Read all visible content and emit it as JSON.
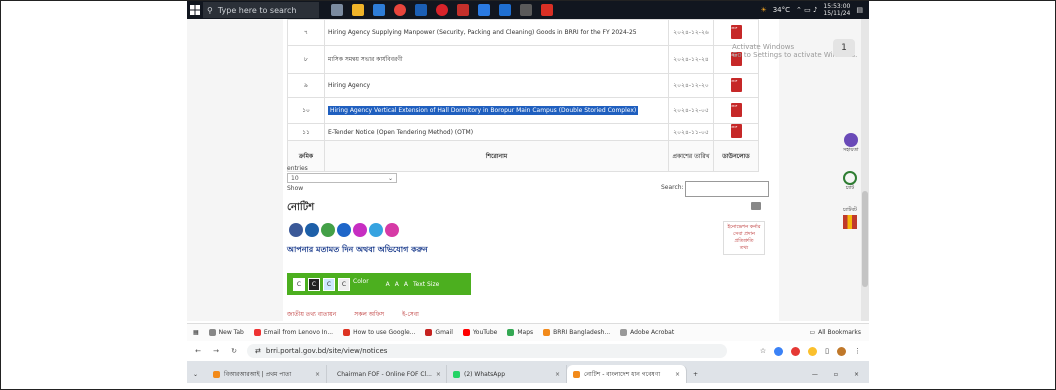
{
  "taskbar": {
    "search_placeholder": "Type here to search",
    "weather": "34°C",
    "time": "15:53:00",
    "date": "15/11/24"
  },
  "table": {
    "headers": [
      "ক্রমিক",
      "শিরোনাম",
      "প্রকাশের তারিখ",
      "ডাউনলোড"
    ],
    "rows": [
      {
        "num": "৭",
        "title": "Hiring Agency Supplying Manpower (Security, Packing and Cleaning) Goods in BRRI for the FY 2024-25",
        "date": "২০২৪-১২-২৬"
      },
      {
        "num": "৮",
        "title": "মাসিক সমন্বয় সভার কার্যবিবরণী",
        "date": "২০২৪-১২-২৪"
      },
      {
        "num": "৯",
        "title": "Hiring Agency",
        "date": "২০২৪-১২-২০"
      },
      {
        "num": "১০",
        "title": "Hiring Agency Vertical Extension of Hall Dormitory in Boropur Main Campus (Double Storied Complex)",
        "date": "২০২৪-১২-০৫"
      },
      {
        "num": "১১",
        "title": "E-Tender Notice (Open Tendering Method) (OTM)",
        "date": "২০২৪-১১-০৫"
      }
    ]
  },
  "controls": {
    "show_label": "Show",
    "entries_value": "10",
    "entries_label": "entries",
    "search_label": "Search:",
    "search_value": ""
  },
  "section": {
    "title": "নোটিশ",
    "feedback": "আপনার মতামত দিন অথবা অভিযোগ করুন",
    "side_links": [
      "ইনোভেশন কর্নার",
      "সেবা প্রদান প্রতিশ্রুতি",
      "তথ্য"
    ]
  },
  "a11y": {
    "text_size_label": "Text Size",
    "size_controls": [
      "A",
      "A",
      "A"
    ],
    "color_label": "Color",
    "color_swatches": [
      "C",
      "C",
      "C",
      "C"
    ]
  },
  "tabs_peek": [
    "জাতীয় তথ্য বাতায়ন",
    "সকল অফিস",
    "ই-সেবা"
  ],
  "watermark": [
    "Activate Windows",
    "Go to Settings to activate Windows."
  ],
  "float_counter": "1",
  "widgets": [
    "সহায়তা",
    "চ্যাট",
    "চ্যাটবট"
  ],
  "bookmarks": {
    "items": [
      "New Tab",
      "Email from Lenovo In...",
      "How to use Google...",
      "Gmail",
      "YouTube",
      "Maps",
      "BRRI Bangladesh...",
      "Adobe Acrobat"
    ],
    "all": "All Bookmarks"
  },
  "address": {
    "url": "brri.portal.gov.bd/site/view/notices"
  },
  "tabs": [
    {
      "label": "বিআরআরআই | প্রথম পাতা",
      "active": false
    },
    {
      "label": "Chairman FOF - Online FOF Cl...",
      "active": false
    },
    {
      "label": "(2) WhatsApp",
      "active": false
    },
    {
      "label": "নোটিশ - বাংলাদেশ ধান গবেষণা",
      "active": true
    }
  ],
  "colors": {
    "taskbar": "#11161f",
    "accent_green": "#4caf1f",
    "link_blue": "#1a3b8c",
    "pdf_red": "#c62828"
  }
}
